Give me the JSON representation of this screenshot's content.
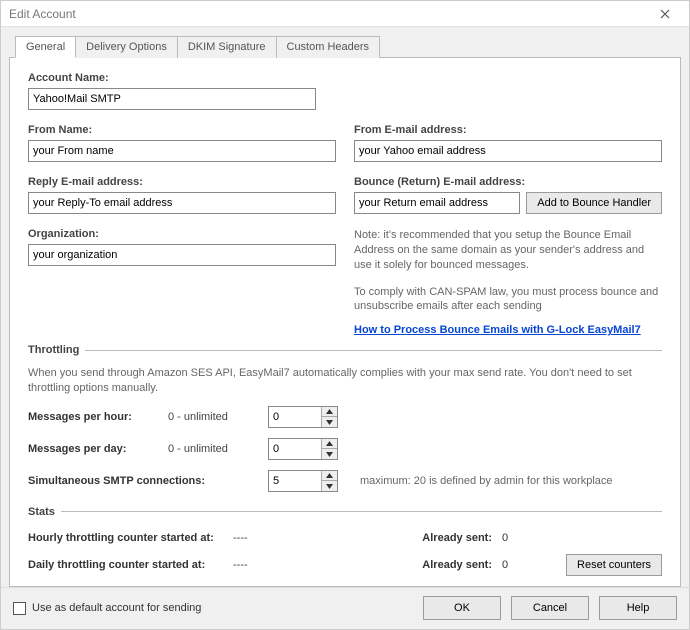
{
  "window": {
    "title": "Edit Account"
  },
  "tabs": {
    "general": "General",
    "delivery": "Delivery Options",
    "dkim": "DKIM Signature",
    "custom_headers": "Custom Headers"
  },
  "fields": {
    "account_name_label": "Account Name:",
    "account_name_value": "Yahoo!Mail SMTP",
    "from_name_label": "From Name:",
    "from_name_value": "your From name",
    "from_email_label": "From E-mail address:",
    "from_email_value": "your Yahoo email address",
    "reply_email_label": "Reply E-mail address:",
    "reply_email_value": "your Reply-To email address",
    "bounce_label": "Bounce (Return) E-mail address:",
    "bounce_value": "your Return email address",
    "add_bounce_btn": "Add to Bounce Handler",
    "org_label": "Organization:",
    "org_value": "your organization"
  },
  "notes": {
    "bounce_note": "Note: it's recommended that you setup the Bounce Email Address on the same domain as your sender's address and use it solely for bounced messages.",
    "canspam_note": "To comply with CAN-SPAM law, you must process bounce and unsubscribe emails after each sending",
    "link_text": "How to Process Bounce Emails with G-Lock EasyMail7"
  },
  "throttling": {
    "legend": "Throttling",
    "desc": "When you send through Amazon SES API, EasyMail7 automatically complies with your max send rate. You don't need to set throttling options manually.",
    "msg_hour_label": "Messages per hour:",
    "msg_hour_hint": "0 - unlimited",
    "msg_hour_value": "0",
    "msg_day_label": "Messages per day:",
    "msg_day_hint": "0 - unlimited",
    "msg_day_value": "0",
    "smtp_label": "Simultaneous SMTP connections:",
    "smtp_value": "5",
    "smtp_max_note": "maximum: 20 is defined by admin for this workplace"
  },
  "stats": {
    "legend": "Stats",
    "hourly_label": "Hourly throttling counter started at:",
    "hourly_value": "----",
    "daily_label": "Daily throttling counter started at:",
    "daily_value": "----",
    "already_sent_label": "Already sent:",
    "hourly_sent": "0",
    "daily_sent": "0",
    "reset_btn": "Reset counters"
  },
  "footer": {
    "default_label": "Use as default account for sending",
    "ok": "OK",
    "cancel": "Cancel",
    "help": "Help"
  }
}
